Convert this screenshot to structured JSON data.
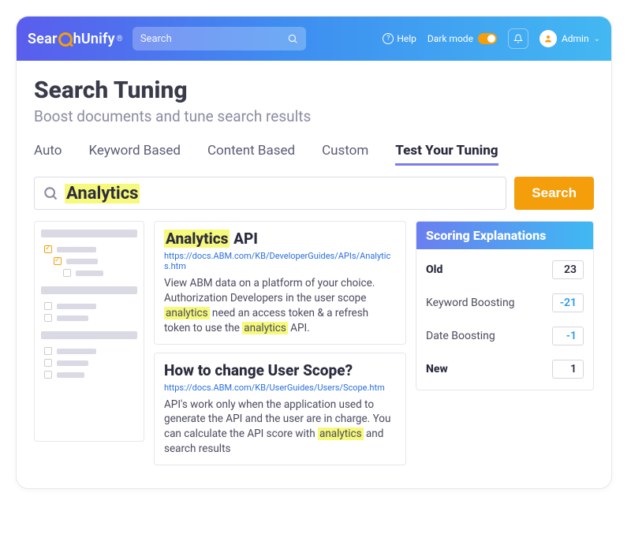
{
  "logo": {
    "segments": [
      "Sear",
      "hUnify"
    ],
    "reg": "®"
  },
  "topbar": {
    "search_placeholder": "Search",
    "help_label": "Help",
    "dark_label": "Dark mode",
    "user_label": "Admin"
  },
  "page": {
    "title": "Search Tuning",
    "subtitle": "Boost documents and tune search results"
  },
  "tabs": [
    "Auto",
    "Keyword Based",
    "Content Based",
    "Custom",
    "Test Your Tuning"
  ],
  "active_tab": 4,
  "search": {
    "query": "Analytics",
    "button": "Search"
  },
  "results": [
    {
      "title_parts": [
        {
          "t": "Analytics",
          "hl": true
        },
        {
          "t": " API",
          "hl": false
        }
      ],
      "url": "https://docs.ABM.com/KB/DeveloperGuides/APIs/Analytics.htm",
      "desc_parts": [
        {
          "t": "View ABM data on a platform of your choice. Authorization Developers in the user scope ",
          "hl": false
        },
        {
          "t": "analytics",
          "hl": true
        },
        {
          "t": " need an access token & a refresh token to use the ",
          "hl": false
        },
        {
          "t": "analytics",
          "hl": true
        },
        {
          "t": " API.",
          "hl": false
        }
      ]
    },
    {
      "title_parts": [
        {
          "t": "How to change User Scope?",
          "hl": false
        }
      ],
      "url": "https://docs.ABM.com/KB/UserGuides/Users/Scope.htm",
      "desc_parts": [
        {
          "t": "API's work only when the application used to generate the API and the user are in charge. You can calculate the API score with ",
          "hl": false
        },
        {
          "t": "analytics",
          "hl": true
        },
        {
          "t": " and search results",
          "hl": false
        }
      ]
    }
  ],
  "scoring": {
    "title": "Scoring Explanations",
    "rows": [
      {
        "label": "Old",
        "value": "23",
        "bold": true,
        "blue": false
      },
      {
        "label": "Keyword Boosting",
        "value": "-21",
        "bold": false,
        "blue": true
      },
      {
        "label": "Date Boosting",
        "value": "-1",
        "bold": false,
        "blue": true
      },
      {
        "label": "New",
        "value": "1",
        "bold": true,
        "blue": false
      }
    ]
  }
}
